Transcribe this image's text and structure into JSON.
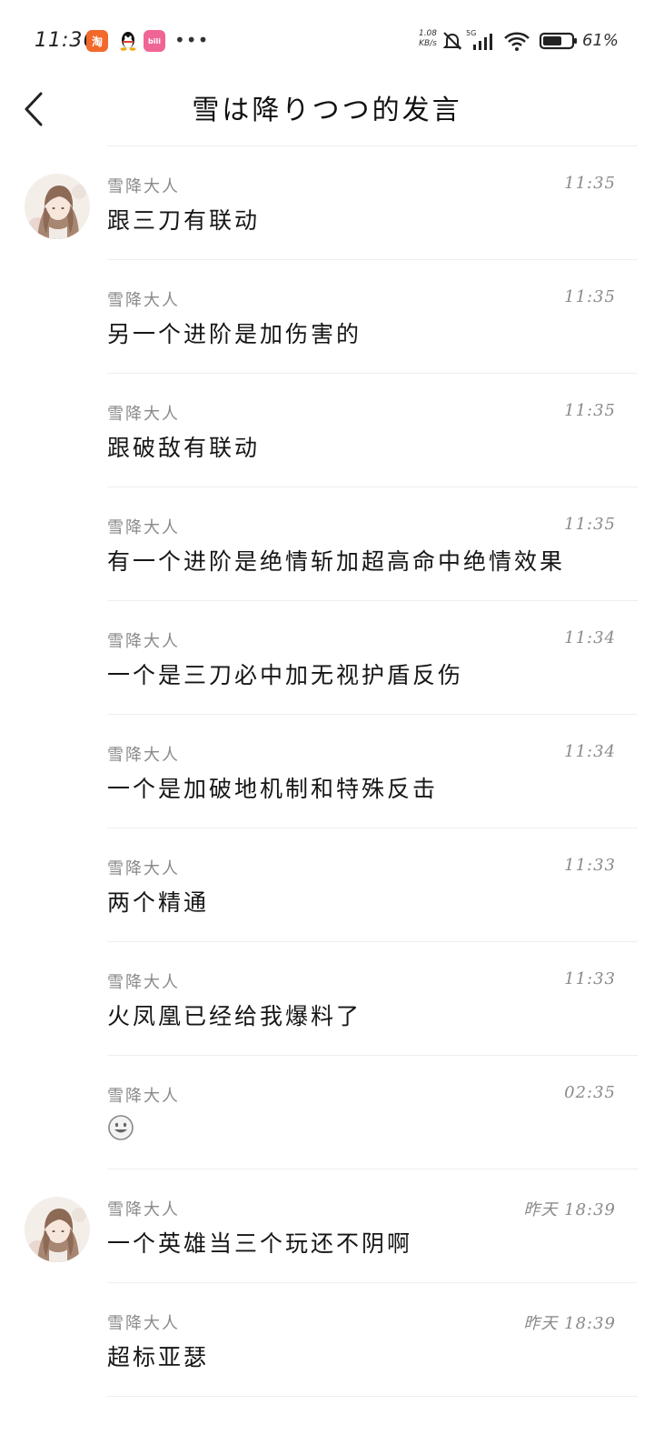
{
  "status_bar": {
    "time": "11:36",
    "app_icons": [
      "taobao-icon",
      "qq-icon",
      "bilibili-icon"
    ],
    "more": "•••",
    "net_speed_value": "1.08",
    "net_speed_unit": "KB/s",
    "network": "5G",
    "battery_percent": "61%"
  },
  "header": {
    "title": "雪は降りつつ的发言"
  },
  "messages": [
    {
      "author": "雪降大人",
      "time": "11:35",
      "text": "跟三刀有联动",
      "show_avatar": true
    },
    {
      "author": "雪降大人",
      "time": "11:35",
      "text": "另一个进阶是加伤害的",
      "show_avatar": false
    },
    {
      "author": "雪降大人",
      "time": "11:35",
      "text": "跟破敌有联动",
      "show_avatar": false
    },
    {
      "author": "雪降大人",
      "time": "11:35",
      "text": "有一个进阶是绝情斩加超高命中绝情效果",
      "show_avatar": false
    },
    {
      "author": "雪降大人",
      "time": "11:34",
      "text": "一个是三刀必中加无视护盾反伤",
      "show_avatar": false
    },
    {
      "author": "雪降大人",
      "time": "11:34",
      "text": "一个是加破地机制和特殊反击",
      "show_avatar": false
    },
    {
      "author": "雪降大人",
      "time": "11:33",
      "text": "两个精通",
      "show_avatar": false
    },
    {
      "author": "雪降大人",
      "time": "11:33",
      "text": "火凤凰已经给我爆料了",
      "show_avatar": false
    },
    {
      "author": "雪降大人",
      "time": "02:35",
      "text": "",
      "emoji": "smile-emoji",
      "show_avatar": false
    },
    {
      "author": "雪降大人",
      "time": "昨天 18:39",
      "text": "一个英雄当三个玩还不阴啊",
      "show_avatar": true
    },
    {
      "author": "雪降大人",
      "time": "昨天 18:39",
      "text": "超标亚瑟",
      "show_avatar": false
    }
  ],
  "colors": {
    "background": "#ffffff",
    "text": "#161616",
    "meta_text": "#8a8a8a",
    "divider": "#eeeeee"
  }
}
